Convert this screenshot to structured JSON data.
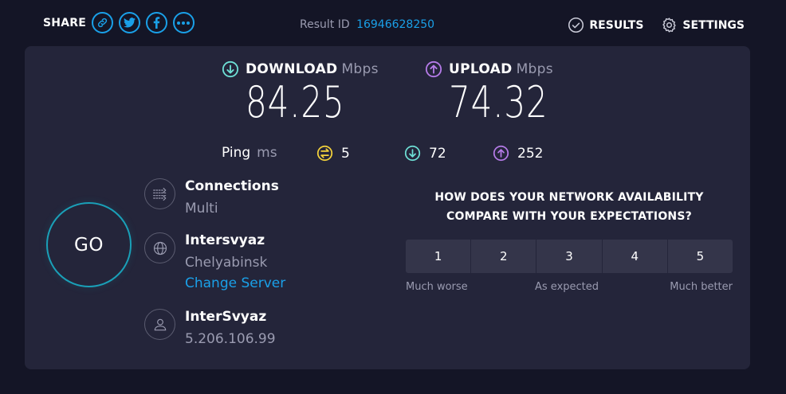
{
  "header": {
    "share_label": "SHARE",
    "share_icons": [
      "link-icon",
      "twitter-icon",
      "facebook-icon",
      "more-icon"
    ],
    "result_id_label": "Result ID",
    "result_id": "16946628250",
    "results_label": "RESULTS",
    "settings_label": "SETTINGS"
  },
  "download": {
    "label": "DOWNLOAD",
    "unit": "Mbps",
    "value": "84.25",
    "color": "#6ee0d6"
  },
  "upload": {
    "label": "UPLOAD",
    "unit": "Mbps",
    "value": "74.32",
    "color": "#b57be8"
  },
  "ping": {
    "label": "Ping",
    "unit": "ms",
    "idle": "5",
    "download": "72",
    "upload": "252",
    "idle_color": "#f5d33b"
  },
  "go_label": "GO",
  "connections": {
    "title": "Connections",
    "value": "Multi"
  },
  "server": {
    "title": "Intersvyaz",
    "location": "Chelyabinsk",
    "change_label": "Change Server"
  },
  "provider": {
    "title": "InterSvyaz",
    "ip": "5.206.106.99"
  },
  "survey": {
    "question_line1": "HOW DOES YOUR NETWORK AVAILABILITY",
    "question_line2": "COMPARE WITH YOUR EXPECTATIONS?",
    "options": [
      "1",
      "2",
      "3",
      "4",
      "5"
    ],
    "low_label": "Much worse",
    "mid_label": "As expected",
    "high_label": "Much better"
  },
  "colors": {
    "accent": "#1aa0e8",
    "background": "#141526",
    "panel": "#24253a"
  }
}
